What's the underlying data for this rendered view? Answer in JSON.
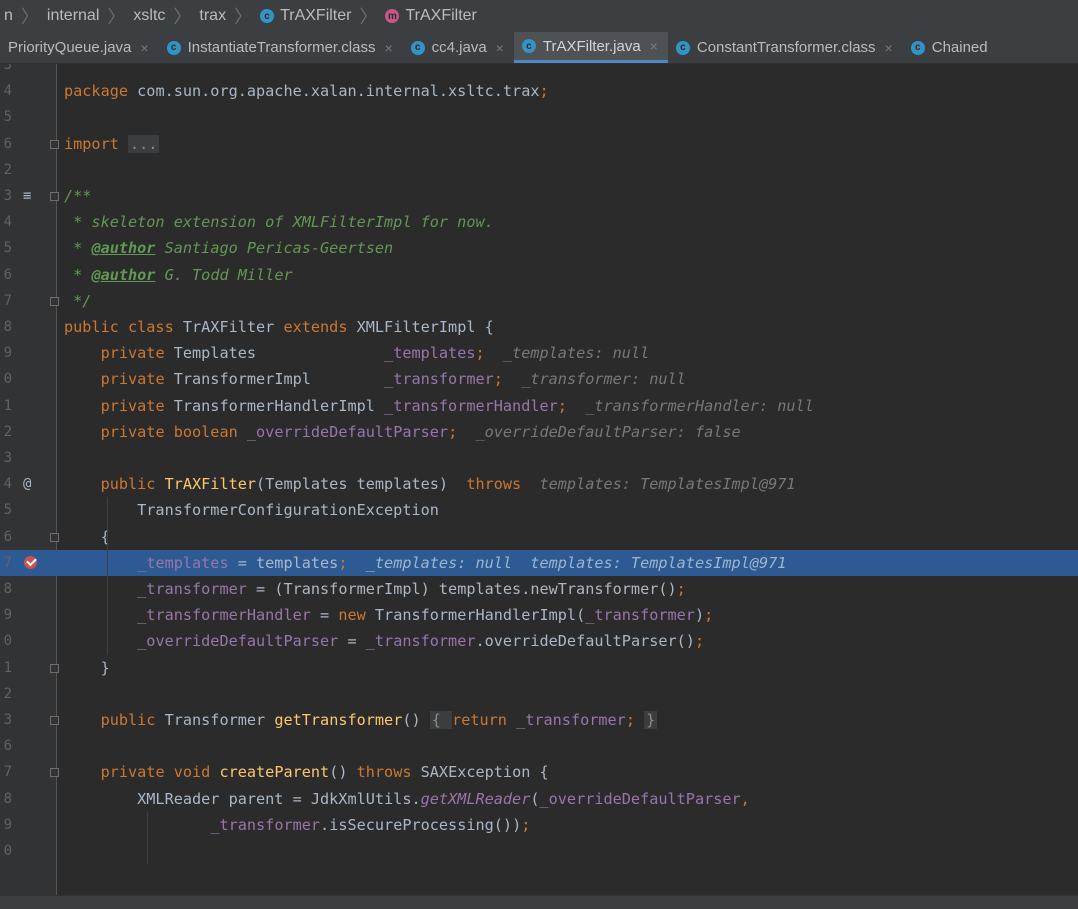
{
  "breadcrumb": [
    {
      "label": "n",
      "icon": ""
    },
    {
      "label": "internal",
      "icon": ""
    },
    {
      "label": "xsltc",
      "icon": ""
    },
    {
      "label": "trax",
      "icon": ""
    },
    {
      "label": "TrAXFilter",
      "icon": "class-icon"
    },
    {
      "label": "TrAXFilter",
      "icon": "method-icon"
    }
  ],
  "tabs": [
    {
      "label": "PriorityQueue.java",
      "close": "×",
      "active": false,
      "icon": ""
    },
    {
      "label": "InstantiateTransformer.class",
      "close": "×",
      "active": false,
      "icon": "class-icon"
    },
    {
      "label": "cc4.java",
      "close": "×",
      "active": false,
      "icon": "class-icon"
    },
    {
      "label": "TrAXFilter.java",
      "close": "×",
      "active": true,
      "icon": "class-icon"
    },
    {
      "label": "ConstantTransformer.class",
      "close": "×",
      "active": false,
      "icon": "class-icon"
    },
    {
      "label": "Chained",
      "close": "",
      "active": false,
      "icon": "class-icon"
    }
  ],
  "editor": {
    "lines": [
      {
        "num": "3",
        "spans": []
      },
      {
        "num": "4",
        "spans": [
          [
            "kw",
            "package "
          ],
          [
            "",
            "com.sun.org.apache.xalan.internal.xsltc.trax"
          ],
          [
            "kw",
            ";"
          ]
        ]
      },
      {
        "num": "5",
        "spans": []
      },
      {
        "num": "6",
        "fold": true,
        "spans": [
          [
            "kw",
            "import "
          ],
          [
            "fbox",
            "..."
          ]
        ]
      },
      {
        "num": "2",
        "spans": []
      },
      {
        "num": "3",
        "fold": true,
        "gmark": "≡",
        "spans": [
          [
            "cm",
            "/**"
          ]
        ]
      },
      {
        "num": "4",
        "spans": [
          [
            "cm",
            " * skeleton extension of XMLFilterImpl for now."
          ]
        ]
      },
      {
        "num": "5",
        "spans": [
          [
            "cm",
            " * "
          ],
          [
            "tag",
            "@author"
          ],
          [
            "cm",
            " Santiago Pericas-Geertsen"
          ]
        ]
      },
      {
        "num": "6",
        "spans": [
          [
            "cm",
            " * "
          ],
          [
            "tag",
            "@author"
          ],
          [
            "cm",
            " G. Todd Miller"
          ]
        ]
      },
      {
        "num": "7",
        "fold": true,
        "spans": [
          [
            "cm",
            " */"
          ]
        ]
      },
      {
        "num": "8",
        "spans": [
          [
            "kw",
            "public class "
          ],
          [
            "",
            "TrAXFilter "
          ],
          [
            "kw",
            "extends "
          ],
          [
            "",
            "XMLFilterImpl {"
          ]
        ]
      },
      {
        "num": "9",
        "spans": [
          [
            "",
            "    "
          ],
          [
            "kw",
            "private "
          ],
          [
            "",
            "Templates              "
          ],
          [
            "fld",
            "_templates"
          ],
          [
            "kw",
            ";"
          ],
          [
            "hint",
            "  _templates: null"
          ]
        ]
      },
      {
        "num": "0",
        "spans": [
          [
            "",
            "    "
          ],
          [
            "kw",
            "private "
          ],
          [
            "",
            "TransformerImpl        "
          ],
          [
            "fld",
            "_transformer"
          ],
          [
            "kw",
            ";"
          ],
          [
            "hint",
            "  _transformer: null"
          ]
        ]
      },
      {
        "num": "1",
        "spans": [
          [
            "",
            "    "
          ],
          [
            "kw",
            "private "
          ],
          [
            "",
            "TransformerHandlerImpl "
          ],
          [
            "fld",
            "_transformerHandler"
          ],
          [
            "kw",
            ";"
          ],
          [
            "hint",
            "  _transformerHandler: null"
          ]
        ]
      },
      {
        "num": "2",
        "spans": [
          [
            "",
            "    "
          ],
          [
            "kw",
            "private boolean "
          ],
          [
            "fld",
            "_overrideDefaultParser"
          ],
          [
            "kw",
            ";"
          ],
          [
            "hint",
            "  _overrideDefaultParser: false"
          ]
        ]
      },
      {
        "num": "3",
        "spans": []
      },
      {
        "num": "4",
        "gmark": "@",
        "spans": [
          [
            "",
            "    "
          ],
          [
            "kw",
            "public "
          ],
          [
            "fn",
            "TrAXFilter"
          ],
          [
            "",
            "(Templates templates)  "
          ],
          [
            "kw",
            "throws"
          ],
          [
            "hint",
            "  templates: TemplatesImpl@971"
          ]
        ]
      },
      {
        "num": "5",
        "spans": [
          [
            "",
            "        TransformerConfigurationException"
          ]
        ]
      },
      {
        "num": "6",
        "fold": true,
        "spans": [
          [
            "",
            "    {"
          ]
        ]
      },
      {
        "num": "7",
        "hl": true,
        "bp": true,
        "spans": [
          [
            "",
            "        "
          ],
          [
            "fld",
            "_templates"
          ],
          [
            "",
            " = templates"
          ],
          [
            "kw",
            ";"
          ],
          [
            "hint",
            "  _templates: null  templates: TemplatesImpl@971"
          ]
        ]
      },
      {
        "num": "8",
        "spans": [
          [
            "",
            "        "
          ],
          [
            "fld",
            "_transformer"
          ],
          [
            "",
            " = (TransformerImpl) templates.newTransformer()"
          ],
          [
            "kw",
            ";"
          ]
        ]
      },
      {
        "num": "9",
        "spans": [
          [
            "",
            "        "
          ],
          [
            "fld",
            "_transformerHandler"
          ],
          [
            "",
            " = "
          ],
          [
            "kw",
            "new "
          ],
          [
            "",
            "TransformerHandlerImpl("
          ],
          [
            "fld",
            "_transformer"
          ],
          [
            "",
            ")"
          ],
          [
            "kw",
            ";"
          ]
        ]
      },
      {
        "num": "0",
        "spans": [
          [
            "",
            "        "
          ],
          [
            "fld",
            "_overrideDefaultParser"
          ],
          [
            "",
            " = "
          ],
          [
            "fld",
            "_transformer"
          ],
          [
            "",
            ".overrideDefaultParser()"
          ],
          [
            "kw",
            ";"
          ]
        ]
      },
      {
        "num": "1",
        "fold": true,
        "spans": [
          [
            "",
            "    }"
          ]
        ]
      },
      {
        "num": "2",
        "spans": []
      },
      {
        "num": "3",
        "fold": true,
        "spans": [
          [
            "",
            "    "
          ],
          [
            "kw",
            "public "
          ],
          [
            "",
            "Transformer "
          ],
          [
            "fn",
            "getTransformer"
          ],
          [
            "",
            "() "
          ],
          [
            "fbox",
            "{ "
          ],
          [
            "kw",
            "return "
          ],
          [
            "fld",
            "_transformer"
          ],
          [
            "kw",
            "; "
          ],
          [
            "fbox",
            "}"
          ]
        ]
      },
      {
        "num": "6",
        "spans": []
      },
      {
        "num": "7",
        "fold": true,
        "spans": [
          [
            "",
            "    "
          ],
          [
            "kw",
            "private void "
          ],
          [
            "fn",
            "createParent"
          ],
          [
            "",
            "() "
          ],
          [
            "kw",
            "throws "
          ],
          [
            "",
            "SAXException {"
          ]
        ]
      },
      {
        "num": "8",
        "spans": [
          [
            "",
            "        XMLReader parent = JdkXmlUtils."
          ],
          [
            "fldi",
            "getXMLReader"
          ],
          [
            "",
            "("
          ],
          [
            "fld",
            "_overrideDefaultParser"
          ],
          [
            "kw",
            ","
          ]
        ]
      },
      {
        "num": "9",
        "spans": [
          [
            "",
            "                "
          ],
          [
            "fld",
            "_transformer"
          ],
          [
            "",
            ".isSecureProcessing())"
          ],
          [
            "kw",
            ";"
          ]
        ]
      },
      {
        "num": "0",
        "spans": []
      },
      {
        "num": "",
        "spans": []
      }
    ]
  }
}
